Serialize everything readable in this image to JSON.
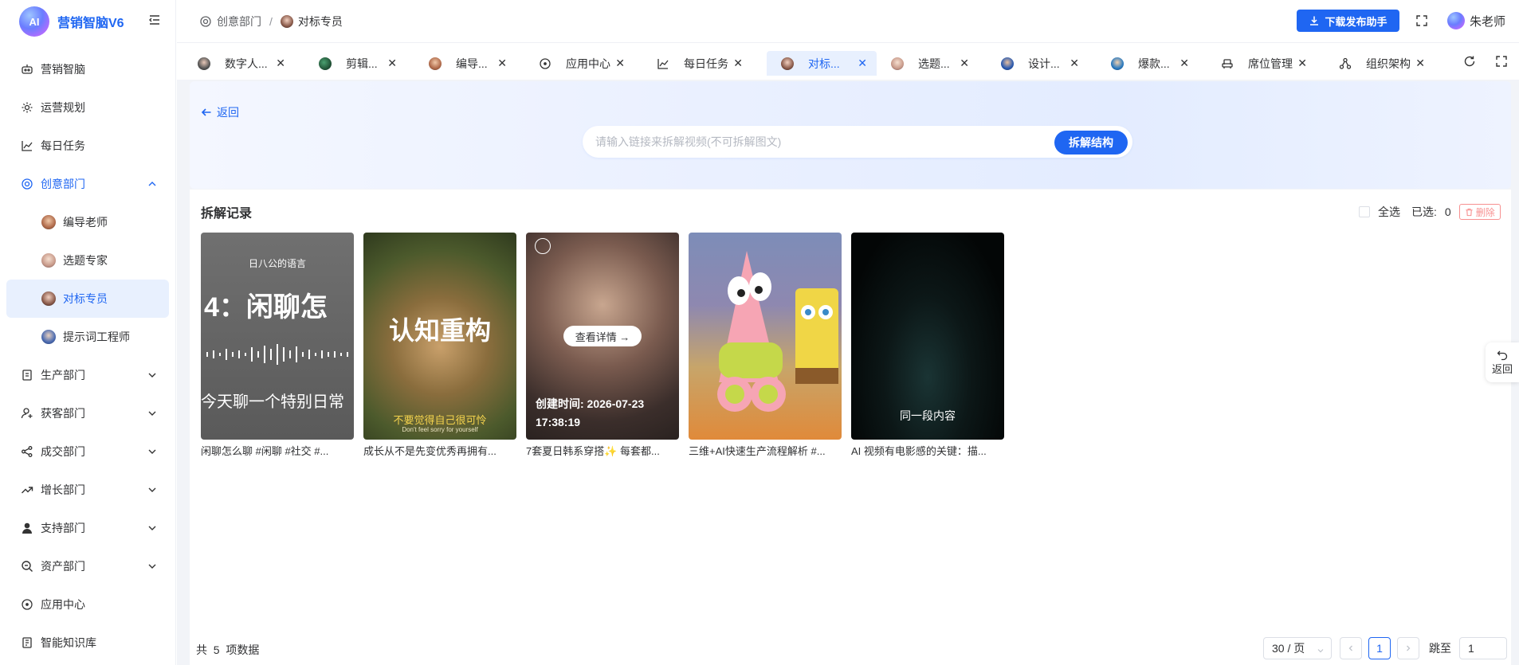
{
  "app": {
    "logo_text": "AI",
    "title": "营销智脑V6"
  },
  "sidebar": {
    "items": [
      {
        "label": "营销智脑",
        "icon": "robot-icon"
      },
      {
        "label": "运营规划",
        "icon": "settings-icon"
      },
      {
        "label": "每日任务",
        "icon": "chart-line-icon"
      },
      {
        "label": "创意部门",
        "icon": "creative-icon",
        "expanded": true,
        "children": [
          {
            "label": "编导老师"
          },
          {
            "label": "选题专家"
          },
          {
            "label": "对标专员",
            "active": true
          },
          {
            "label": "提示词工程师"
          }
        ]
      },
      {
        "label": "生产部门",
        "icon": "production-icon"
      },
      {
        "label": "获客部门",
        "icon": "user-add-icon"
      },
      {
        "label": "成交部门",
        "icon": "share-icon"
      },
      {
        "label": "增长部门",
        "icon": "trend-icon"
      },
      {
        "label": "支持部门",
        "icon": "support-icon"
      },
      {
        "label": "资产部门",
        "icon": "search-asset-icon"
      },
      {
        "label": "应用中心",
        "icon": "app-center-icon"
      },
      {
        "label": "智能知识库",
        "icon": "book-icon"
      }
    ]
  },
  "header": {
    "breadcrumb": [
      "创意部门",
      "对标专员"
    ],
    "download_label": "下载发布助手",
    "user_name": "朱老师"
  },
  "tabs": [
    {
      "label": "数字人...",
      "active": false
    },
    {
      "label": "剪辑...",
      "active": false
    },
    {
      "label": "编导...",
      "active": false
    },
    {
      "label": "应用中心",
      "active": false
    },
    {
      "label": "每日任务",
      "active": false
    },
    {
      "label": "对标...",
      "active": true
    },
    {
      "label": "选题...",
      "active": false
    },
    {
      "label": "设计...",
      "active": false
    },
    {
      "label": "爆款...",
      "active": false
    },
    {
      "label": "席位管理",
      "active": false
    },
    {
      "label": "组织架构",
      "active": false
    }
  ],
  "hero": {
    "back_label": "返回",
    "search_placeholder": "请输入链接来拆解视频(不可拆解图文)",
    "search_value": "",
    "submit_label": "拆解结构"
  },
  "records": {
    "title": "拆解记录",
    "select_all_label": "全选",
    "selected_label": "已选:",
    "selected_count": "0",
    "delete_label": "删除",
    "cards": [
      {
        "caption": "闲聊怎么聊 #闲聊 #社交 #...",
        "overlay_top": "日八公的语言",
        "overlay_main": "4：闲聊怎",
        "overlay_bottom": "今天聊一个特别日常"
      },
      {
        "caption": "成长从不是先变优秀再拥有...",
        "overlay_main": "认知重构",
        "overlay_bottom": "不要觉得自己很可怜",
        "overlay_small": "Don't feel sorry for yourself"
      },
      {
        "caption": "7套夏日韩系穿搭✨ 每套都...",
        "detail_label": "查看详情 →",
        "created_label": "创建时间: 2026-07-23",
        "created_time": "17:38:19"
      },
      {
        "caption": "三维+AI快速生产流程解析 #..."
      },
      {
        "caption": "AI 视频有电影感的关键：描...",
        "overlay_bottom": "同一段内容"
      }
    ]
  },
  "pagination": {
    "total_prefix": "共",
    "total_count": "5",
    "total_suffix": "项数据",
    "page_size_label": "30 / 页",
    "current_page": "1",
    "jump_label": "跳至",
    "jump_value": "1"
  },
  "float_back_label": "返回",
  "colors": {
    "primary": "#1f66f2",
    "danger": "#f56c6c",
    "active_bg": "#e8f0fe"
  }
}
